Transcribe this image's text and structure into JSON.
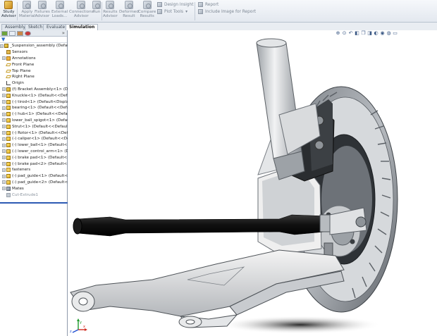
{
  "ribbon": {
    "buttons": [
      {
        "id": "study",
        "label": "Study\nAdvisor",
        "active": true
      },
      {
        "id": "apply_material",
        "label": "Apply\nMaterial"
      },
      {
        "id": "fixtures",
        "label": "Fixtures\nAdvisor"
      },
      {
        "id": "external_loads",
        "label": "External\nLoads..."
      },
      {
        "id": "connections",
        "label": "Connections\nAdvisor"
      },
      {
        "id": "run",
        "label": "Run"
      },
      {
        "id": "results",
        "label": "Results\nAdvisor"
      },
      {
        "id": "deformed",
        "label": "Deformed\nResult"
      },
      {
        "id": "compare",
        "label": "Compare\nResults"
      }
    ],
    "design_insight": "Design Insight",
    "plot_tools": "Plot Tools",
    "report": "Report",
    "include_image": "Include Image for Report"
  },
  "tabs": [
    "Assembly",
    "Sketch",
    "Evaluate",
    "Simulation"
  ],
  "active_tab": "Simulation",
  "tree": {
    "items": [
      {
        "label": "_Suspension_assembly  (Default<",
        "icon": "asm",
        "indent": 0
      },
      {
        "label": "Sensors",
        "icon": "sensor",
        "indent": 1
      },
      {
        "label": "Annotations",
        "icon": "annot",
        "indent": 1,
        "expand": true
      },
      {
        "label": "Front Plane",
        "icon": "plane",
        "indent": 1
      },
      {
        "label": "Top Plane",
        "icon": "plane",
        "indent": 1
      },
      {
        "label": "Right Plane",
        "icon": "plane",
        "indent": 1
      },
      {
        "label": "Origin",
        "icon": "origin",
        "indent": 1
      },
      {
        "label": "(f) Bracket Assembly<1> (De",
        "icon": "asm",
        "indent": 1,
        "expand": true
      },
      {
        "label": "Knuckle<1> (Default<<Defaul",
        "icon": "part",
        "indent": 1,
        "expand": true
      },
      {
        "label": "(-) tirod<1> (Default<Display",
        "icon": "part",
        "indent": 1,
        "expand": true
      },
      {
        "label": "bearing<1> (Default<<Defaul",
        "icon": "part",
        "indent": 1,
        "expand": true
      },
      {
        "label": "(-) hub<1> (Default<<Default",
        "icon": "part",
        "indent": 1,
        "expand": true
      },
      {
        "label": "lower_ball_spigot<1> (Defaul",
        "icon": "part",
        "indent": 1,
        "expand": true
      },
      {
        "label": "Strut<1> (Default<<Default>",
        "icon": "part",
        "indent": 1,
        "expand": true
      },
      {
        "label": "(-) Rotor<1> (Default<<Defau",
        "icon": "part",
        "indent": 1,
        "expand": true
      },
      {
        "label": "(-) caliper<1> (Default<<Def",
        "icon": "part",
        "indent": 1,
        "expand": true
      },
      {
        "label": "(-) lower_ball<1> (Default<<",
        "icon": "part",
        "indent": 1,
        "expand": true
      },
      {
        "label": "(-) lower_control_arm<1> (D",
        "icon": "part",
        "indent": 1,
        "expand": true
      },
      {
        "label": "(-) brake pad<1> (Default<<",
        "icon": "part",
        "indent": 1,
        "expand": true
      },
      {
        "label": "(-) brake pad<2> (Default<<",
        "icon": "part",
        "indent": 1,
        "expand": true
      },
      {
        "label": "fasteners",
        "icon": "folder",
        "indent": 1,
        "expand": true
      },
      {
        "label": "(-) pad_guide<1> (Default<<",
        "icon": "part",
        "indent": 1,
        "expand": true
      },
      {
        "label": "(-) pad_guide<2> (Default<<",
        "icon": "part",
        "indent": 1,
        "expand": true
      },
      {
        "label": "Mates",
        "icon": "mates",
        "indent": 1,
        "expand": true
      },
      {
        "label": "Cut-Extrude1",
        "icon": "cut",
        "indent": 1,
        "grey": true
      }
    ]
  },
  "hud_icons": [
    "zoom-fit-icon",
    "zoom-area-icon",
    "previous-view-icon",
    "section-view-icon",
    "view-orientation-icon",
    "display-style-icon",
    "hide-show-icon",
    "edit-appearance-icon",
    "apply-scene-icon",
    "view-settings-icon"
  ],
  "triad": {
    "x": "x",
    "y": "y",
    "z": "z"
  }
}
